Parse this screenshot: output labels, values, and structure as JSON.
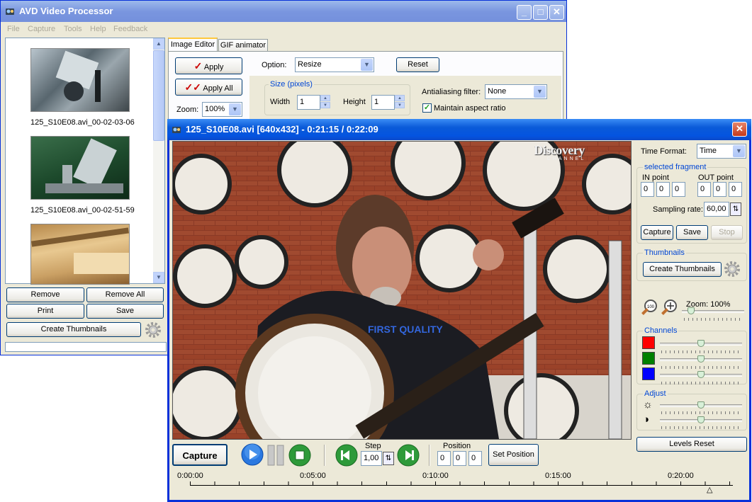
{
  "main_window": {
    "title": "AVD Video Processor",
    "menu": [
      "File",
      "Capture",
      "Tools",
      "Help",
      "Feedback"
    ],
    "thumbnails": [
      {
        "caption": "125_S10E08.avi_00-02-03-06"
      },
      {
        "caption": "125_S10E08.avi_00-02-51-59"
      },
      {
        "caption": ""
      }
    ],
    "buttons": {
      "remove": "Remove",
      "remove_all": "Remove All",
      "print": "Print",
      "save": "Save",
      "create_thumbnails": "Create Thumbnails"
    },
    "tabs": [
      "Image Editor",
      "GIF animator"
    ],
    "editor": {
      "apply": "Apply",
      "apply_all": "Apply All",
      "zoom_label": "Zoom:",
      "zoom_value": "100%",
      "option_label": "Option:",
      "option_value": "Resize",
      "reset": "Reset",
      "size_group": "Size (pixels)",
      "width_label": "Width",
      "width_value": "1",
      "height_label": "Height",
      "height_value": "1",
      "aa_label": "Antialiasing filter:",
      "aa_value": "None",
      "maintain_aspect": "Maintain aspect ratio"
    }
  },
  "player_window": {
    "title": "125_S10E08.avi [640x432] - 0:21:15 / 0:22:09",
    "watermark_top": "Discovery",
    "watermark_bottom": "CHANNEL",
    "shirt_text": "FIRST QUALITY",
    "time_format_label": "Time Format:",
    "time_format_value": "Time",
    "fragment_group": "selected fragment",
    "in_point_label": "IN point",
    "out_point_label": "OUT point",
    "in_point": [
      "0",
      "0",
      "0"
    ],
    "out_point": [
      "0",
      "0",
      "0"
    ],
    "sampling_label": "Sampling rate:",
    "sampling_value": "60,00",
    "capture_small": "Capture",
    "save": "Save",
    "stop": "Stop",
    "thumbnails_group": "Thumbnails",
    "create_thumbnails": "Create Thumbnails",
    "zoom_label": "Zoom: 100%",
    "zoom_slider": 0.1,
    "channels_group": "Channels",
    "channels": [
      {
        "color": "#ff0000",
        "level": 0.5
      },
      {
        "color": "#008000",
        "level": 0.5
      },
      {
        "color": "#0000ff",
        "level": 0.5
      }
    ],
    "adjust_group": "Adjust",
    "brightness_level": 0.5,
    "contrast_level": 0.5,
    "levels_reset": "Levels Reset",
    "capture": "Capture",
    "step_label": "Step",
    "step_value": "1,00",
    "position_label": "Position",
    "position": [
      "0",
      "0",
      "0"
    ],
    "set_position": "Set Position",
    "timeline_labels": [
      "0:00:00",
      "0:05:00",
      "0:10:00",
      "0:15:00",
      "0:20:00"
    ],
    "timeline_marker": "△",
    "icons": {
      "play": "play-icon",
      "pause": "pause-icon",
      "stop": "stop-icon",
      "prev": "step-back-icon",
      "next": "step-forward-icon",
      "gear": "gear-icon"
    }
  }
}
